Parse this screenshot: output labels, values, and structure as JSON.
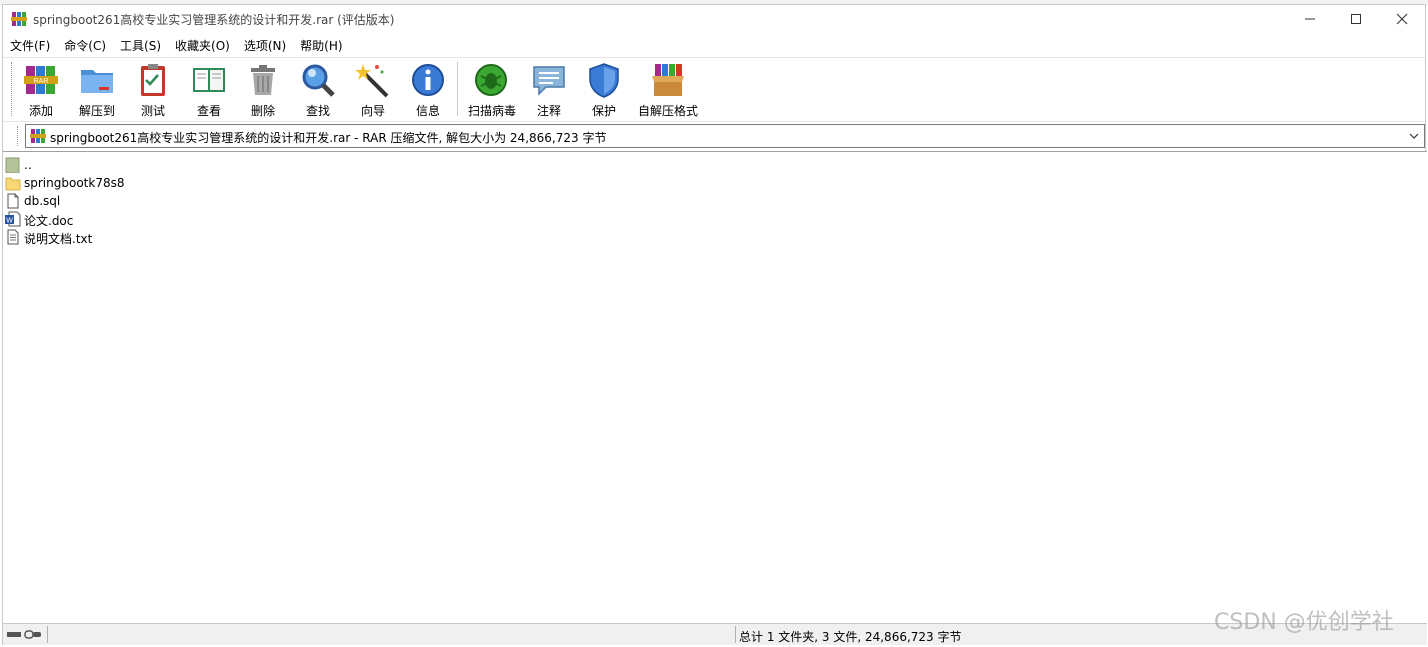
{
  "window": {
    "title": "springboot261高校专业实习管理系统的设计和开发.rar (评估版本)",
    "buttons": {
      "minimize": "—",
      "maximize": "☐",
      "close": "✕"
    }
  },
  "menu": [
    {
      "label": "文件(F)"
    },
    {
      "label": "命令(C)"
    },
    {
      "label": "工具(S)"
    },
    {
      "label": "收藏夹(O)"
    },
    {
      "label": "选项(N)"
    },
    {
      "label": "帮助(H)"
    }
  ],
  "toolbar": [
    {
      "label": "添加",
      "icon": "add-archive-icon"
    },
    {
      "label": "解压到",
      "icon": "extract-folder-icon"
    },
    {
      "label": "测试",
      "icon": "test-clipboard-icon"
    },
    {
      "label": "查看",
      "icon": "view-book-icon"
    },
    {
      "label": "删除",
      "icon": "trash-icon"
    },
    {
      "label": "查找",
      "icon": "magnifier-icon"
    },
    {
      "label": "向导",
      "icon": "wizard-wand-icon"
    },
    {
      "label": "信息",
      "icon": "info-icon"
    },
    {
      "label": "扫描病毒",
      "icon": "virus-scan-icon"
    },
    {
      "label": "注释",
      "icon": "comment-icon"
    },
    {
      "label": "保护",
      "icon": "shield-icon"
    },
    {
      "label": "自解压格式",
      "icon": "sfx-box-icon"
    }
  ],
  "address": {
    "text": "springboot261高校专业实习管理系统的设计和开发.rar - RAR 压缩文件, 解包大小为 24,866,723 字节"
  },
  "files": [
    {
      "name": "..",
      "type": "parent"
    },
    {
      "name": "springbootk78s8",
      "type": "folder"
    },
    {
      "name": "db.sql",
      "type": "file"
    },
    {
      "name": "论文.doc",
      "type": "word"
    },
    {
      "name": "说明文档.txt",
      "type": "text"
    }
  ],
  "status": {
    "summary": "总计 1 文件夹, 3 文件, 24,866,723 字节"
  },
  "watermark": "CSDN @优创学社",
  "colors": {
    "folder": "#f8d775",
    "parent": "#b5c39a",
    "word_blue": "#2b579a",
    "scan_green": "#3aa832",
    "shield_blue": "#3a7bd5"
  }
}
